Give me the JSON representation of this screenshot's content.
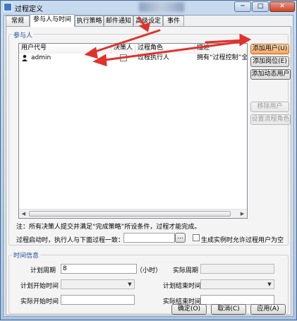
{
  "window": {
    "title": "过程定义",
    "controls": {
      "minimize": "─",
      "maximize": "□",
      "close": "✕"
    }
  },
  "tabs": [
    "常规",
    "参与人与时间",
    "执行策略",
    "邮件通知",
    "高级设定",
    "事件"
  ],
  "participants": {
    "legend": "参与人",
    "columns": [
      "用户代号",
      "决策人",
      "过程角色",
      "描述"
    ],
    "rows": [
      {
        "user": "admin",
        "decision": "",
        "role": "过程执行人",
        "desc": "拥有“过程控制”全"
      }
    ],
    "buttons": {
      "add_user": "添加用户(U)",
      "add_post": "添加岗位(E)",
      "add_dynamic_user": "添加动态用户",
      "remove_user": "移除用户",
      "set_role": "设置流程角色"
    },
    "note": "注：所有决策人提交并满足“完成策略”所设条件，过程才能完成。",
    "start_label": "过程启动时，执行人与下面过程一致：",
    "start_value": "",
    "browse": "...",
    "allow_empty_label": "生成实例时允许过程用户为空"
  },
  "time_info": {
    "legend": "时间信息",
    "plan_period_label": "计划周期",
    "plan_period_value": "8",
    "unit": "（小时）",
    "actual_period_label": "实际周期",
    "actual_period_value": "",
    "plan_start_label": "计划开始时间",
    "plan_start_value": "",
    "plan_end_label": "计划结束时间",
    "plan_end_value": "",
    "actual_start_label": "实际开始时间",
    "actual_start_value": "",
    "actual_end_label": "实际结束时间",
    "actual_end_value": ""
  },
  "footer": {
    "ok": "确定(O)",
    "cancel": "取消(C)",
    "apply": "应用(A)"
  },
  "colors": {
    "accent_arrow": "#e0322b",
    "highlight_button": "#f6a35d",
    "legend_text": "#1d4a8f"
  }
}
